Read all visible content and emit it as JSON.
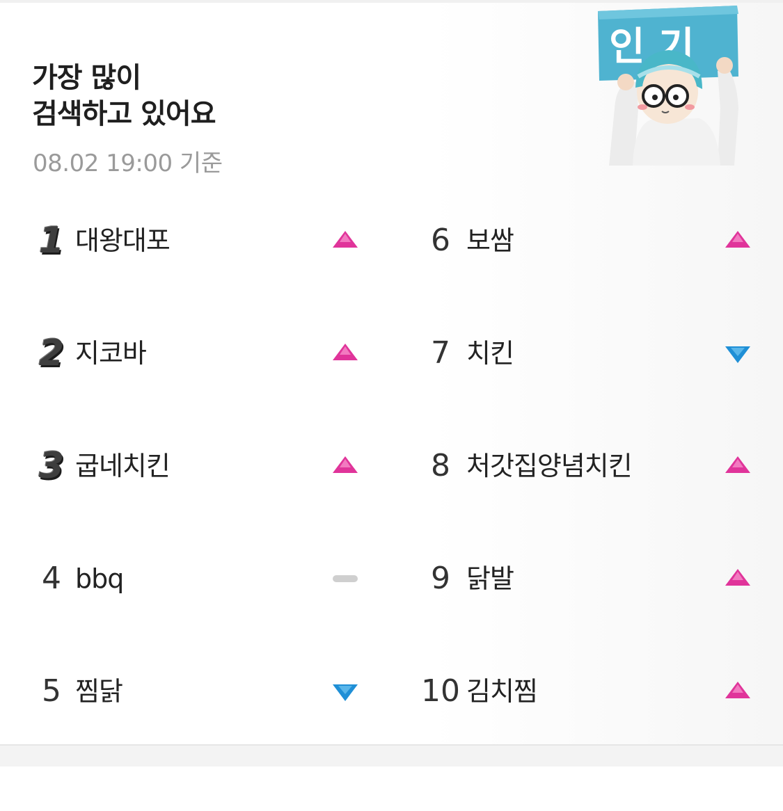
{
  "header": {
    "title_line1": "가장 많이",
    "title_line2": "검색하고 있어요",
    "timestamp": "08.02 19:00 기준",
    "badge_text": "인 기"
  },
  "rankings": [
    {
      "rank": "1",
      "keyword": "대왕대포",
      "trend": "up"
    },
    {
      "rank": "2",
      "keyword": "지코바",
      "trend": "up"
    },
    {
      "rank": "3",
      "keyword": "굽네치킨",
      "trend": "up"
    },
    {
      "rank": "4",
      "keyword": "bbq",
      "trend": "same"
    },
    {
      "rank": "5",
      "keyword": "찜닭",
      "trend": "down"
    },
    {
      "rank": "6",
      "keyword": "보쌈",
      "trend": "up"
    },
    {
      "rank": "7",
      "keyword": "치킨",
      "trend": "down"
    },
    {
      "rank": "8",
      "keyword": "처갓집양념치킨",
      "trend": "up"
    },
    {
      "rank": "9",
      "keyword": "닭발",
      "trend": "up"
    },
    {
      "rank": "10",
      "keyword": "김치찜",
      "trend": "up"
    }
  ],
  "colors": {
    "up": "#e0349a",
    "down": "#1f8fd6",
    "same": "#cfcfcf",
    "badge": "#4fb3d0"
  }
}
